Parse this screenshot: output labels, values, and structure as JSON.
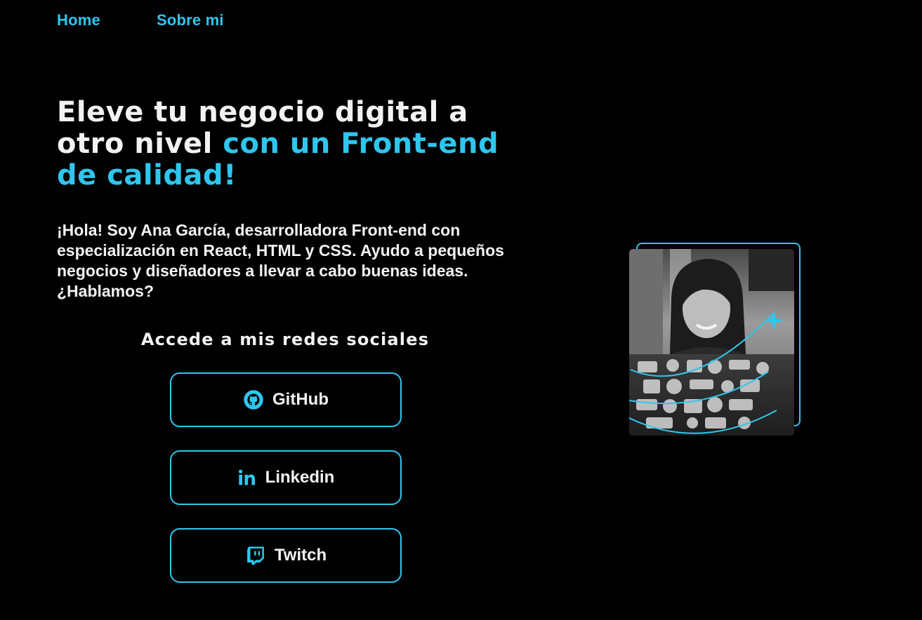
{
  "nav": {
    "home": "Home",
    "about": "Sobre mi"
  },
  "hero": {
    "headline_part1": "Eleve tu negocio digital a otro nivel ",
    "headline_accent": "con un Front-end de calidad!",
    "intro": "¡Hola! Soy Ana García, desarrolladora Front-end con especialización en React, HTML y CSS. Ayudo a pequeños negocios y diseñadores a llevar a cabo buenas ideas. ¿Hablamos?"
  },
  "social": {
    "title": "Accede a mis redes sociales",
    "github": {
      "label": "GitHub",
      "icon": "github-icon"
    },
    "linkedin": {
      "label": "Linkedin",
      "icon": "linkedin-icon"
    },
    "twitch": {
      "label": "Twitch",
      "icon": "twitch-icon"
    }
  },
  "colors": {
    "accent": "#2fc6ee",
    "background": "#000000",
    "text": "#f2f2f2"
  }
}
